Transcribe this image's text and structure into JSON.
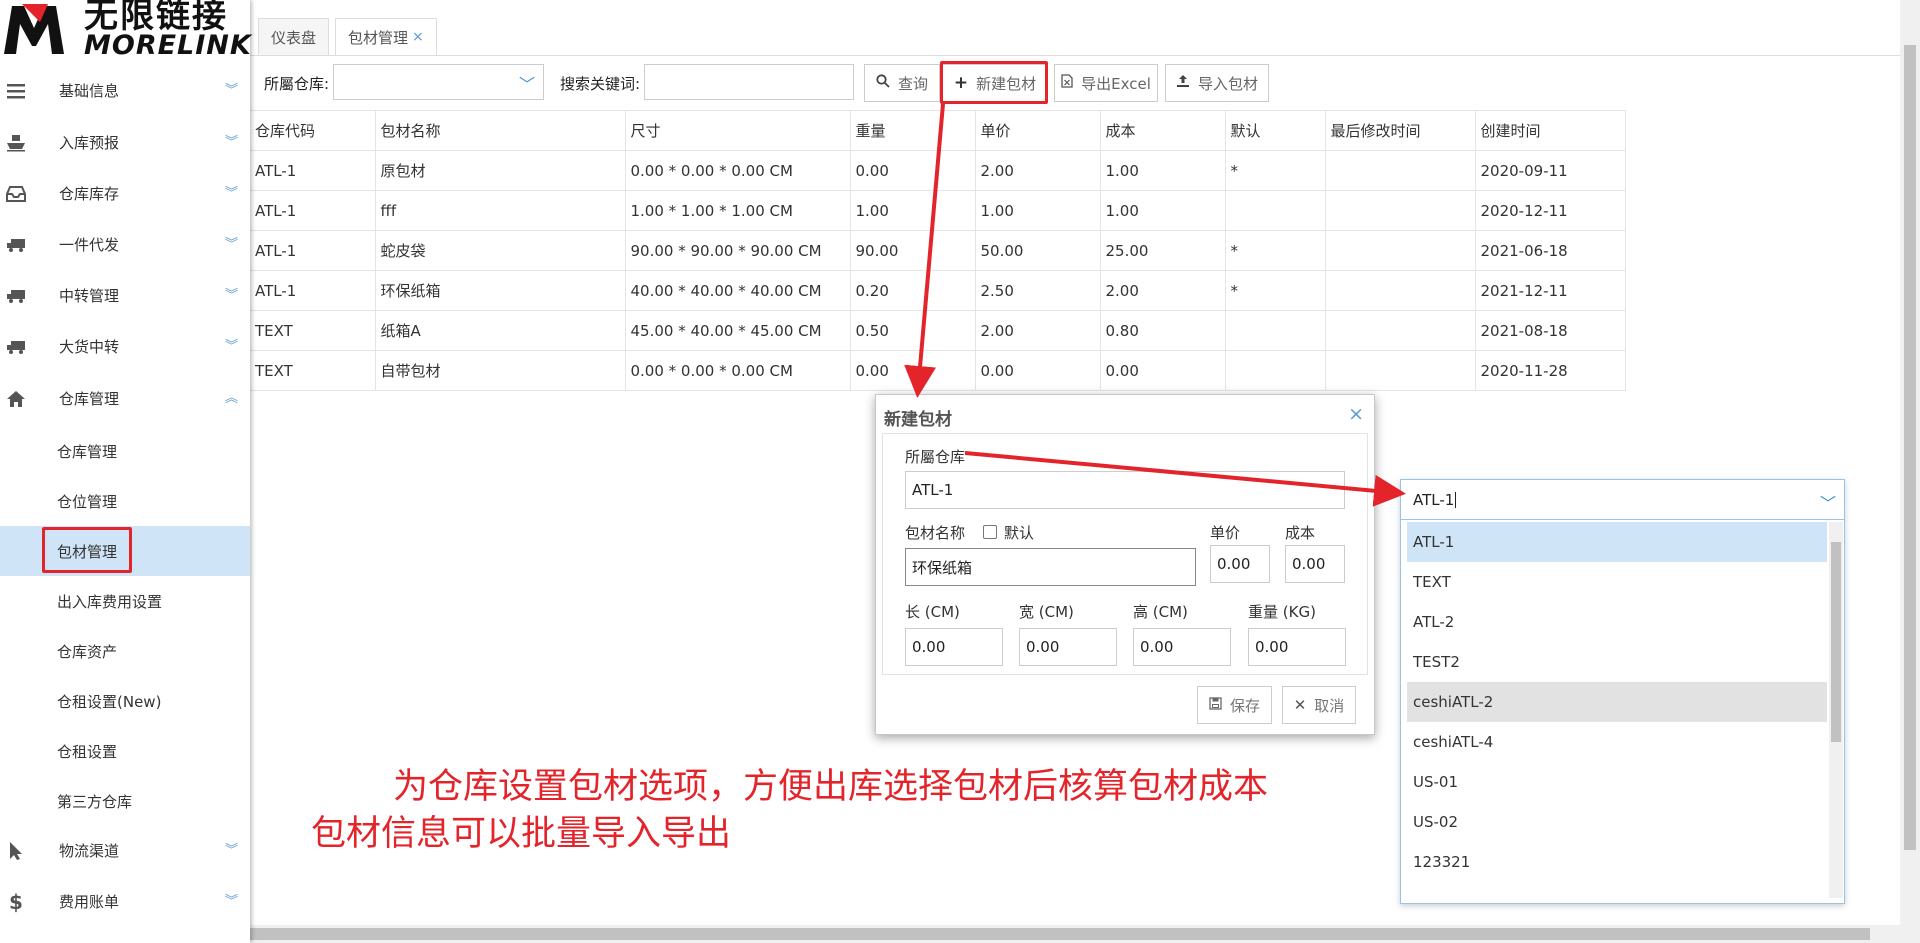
{
  "brand": {
    "cn": "无限链接",
    "en": "MORELINK"
  },
  "sidebar": {
    "items": [
      {
        "label": "基础信息",
        "icon": "menu-icon",
        "expanded": false
      },
      {
        "label": "入库预报",
        "icon": "ship-icon",
        "expanded": false
      },
      {
        "label": "仓库库存",
        "icon": "inbox-icon",
        "expanded": false
      },
      {
        "label": "一件代发",
        "icon": "truck-icon",
        "expanded": false
      },
      {
        "label": "中转管理",
        "icon": "truck-icon",
        "expanded": false
      },
      {
        "label": "大货中转",
        "icon": "truck-icon",
        "expanded": false
      },
      {
        "label": "仓库管理",
        "icon": "home-icon",
        "expanded": true
      },
      {
        "label": "物流渠道",
        "icon": "cursor-icon",
        "expanded": false
      },
      {
        "label": "费用账单",
        "icon": "dollar-icon",
        "expanded": false
      }
    ],
    "subitems": [
      "仓库管理",
      "仓位管理",
      "包材管理",
      "出入库费用设置",
      "仓库资产",
      "仓租设置(New)",
      "仓租设置",
      "第三方仓库"
    ],
    "active_sub": "包材管理"
  },
  "tabs": [
    {
      "label": "仪表盘"
    },
    {
      "label": "包材管理",
      "close": "×"
    }
  ],
  "toolbar": {
    "warehouse_label": "所屬仓库:",
    "keyword_label": "搜索关键词:",
    "query_label": "查询",
    "new_label": "新建包材",
    "export_label": "导出Excel",
    "import_label": "导入包材"
  },
  "table": {
    "headers": [
      "仓库代码",
      "包材名称",
      "尺寸",
      "重量",
      "单价",
      "成本",
      "默认",
      "最后修改时间",
      "创建时间"
    ],
    "rows": [
      [
        "ATL-1",
        "原包材",
        "0.00 * 0.00 * 0.00 CM",
        "0.00",
        "2.00",
        "1.00",
        "*",
        "",
        "2020-09-11"
      ],
      [
        "ATL-1",
        "fff",
        "1.00 * 1.00 * 1.00 CM",
        "1.00",
        "1.00",
        "1.00",
        "",
        "",
        "2020-12-11"
      ],
      [
        "ATL-1",
        "蛇皮袋",
        "90.00 * 90.00 * 90.00 CM",
        "90.00",
        "50.00",
        "25.00",
        "*",
        "",
        "2021-06-18"
      ],
      [
        "ATL-1",
        "环保纸箱",
        "40.00 * 40.00 * 40.00 CM",
        "0.20",
        "2.50",
        "2.00",
        "*",
        "",
        "2021-12-11"
      ],
      [
        "TEXT",
        "纸箱A",
        "45.00 * 40.00 * 45.00 CM",
        "0.50",
        "2.00",
        "0.80",
        "",
        "",
        "2021-08-18"
      ],
      [
        "TEXT",
        "自带包材",
        "0.00 * 0.00 * 0.00 CM",
        "0.00",
        "0.00",
        "0.00",
        "",
        "",
        "2020-11-28"
      ]
    ]
  },
  "dialog": {
    "title": "新建包材",
    "close": "×",
    "warehouse_label": "所屬仓库",
    "warehouse_value": "ATL-1",
    "name_label": "包材名称",
    "default_label": "默认",
    "price_label": "单价",
    "cost_label": "成本",
    "name_value": "环保纸箱",
    "price_value": "0.00",
    "cost_value": "0.00",
    "length_label": "长 (CM)",
    "width_label": "宽 (CM)",
    "height_label": "高 (CM)",
    "weight_label": "重量 (KG)",
    "length_value": "0.00",
    "width_value": "0.00",
    "height_value": "0.00",
    "weight_value": "0.00",
    "save_label": "保存",
    "cancel_label": "取消"
  },
  "dropdown": {
    "value": "ATL-1",
    "options": [
      "ATL-1",
      "TEXT",
      "ATL-2",
      "TEST2",
      "ceshiATL-2",
      "ceshiATL-4",
      "US-01",
      "US-02",
      "123321"
    ],
    "selected": "ATL-1",
    "hovered": "ceshiATL-2"
  },
  "annotations": {
    "line1": "为仓库设置包材选项，方便出库选择包材后核算包材成本",
    "line2": "包材信息可以批量导入导出"
  },
  "colors": {
    "accent": "#5b9bd5",
    "highlight": "#e3242b",
    "selected": "#cfe5f7"
  }
}
